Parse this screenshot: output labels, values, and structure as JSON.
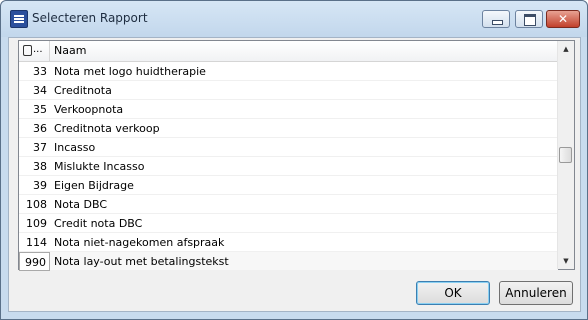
{
  "window": {
    "title": "Selecteren Rapport",
    "close_glyph": "✕"
  },
  "grid": {
    "header": {
      "id_label": "...",
      "name_label": "Naam"
    },
    "rows": [
      {
        "id": "33",
        "name": "Nota met logo huidtherapie"
      },
      {
        "id": "34",
        "name": "Creditnota"
      },
      {
        "id": "35",
        "name": "Verkoopnota"
      },
      {
        "id": "36",
        "name": "Creditnota verkoop"
      },
      {
        "id": "37",
        "name": "Incasso"
      },
      {
        "id": "38",
        "name": "Mislukte Incasso"
      },
      {
        "id": "39",
        "name": "Eigen Bijdrage"
      },
      {
        "id": "108",
        "name": "Nota DBC"
      },
      {
        "id": "109",
        "name": "Credit nota DBC"
      },
      {
        "id": "114",
        "name": "Nota niet-nagekomen afspraak"
      },
      {
        "id": "990",
        "name": "Nota lay-out met betalingstekst"
      }
    ],
    "selected_row_index": 10,
    "scroll_position_fraction": 0.5
  },
  "buttons": {
    "ok_label": "OK",
    "cancel_label": "Annuleren"
  },
  "colors": {
    "titlebar": "#c8dbee",
    "selection_border": "#a9a9a9"
  }
}
